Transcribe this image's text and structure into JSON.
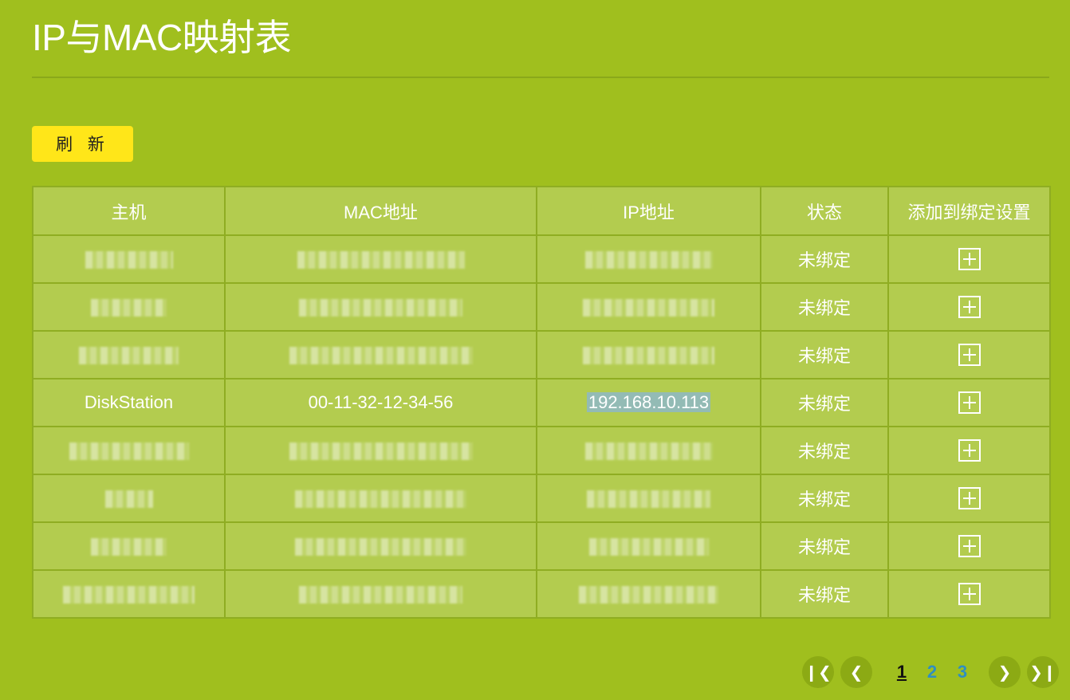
{
  "page": {
    "title": "IP与MAC映射表"
  },
  "toolbar": {
    "refresh_label": "刷 新"
  },
  "table": {
    "headers": {
      "host": "主机",
      "mac": "MAC地址",
      "ip": "IP地址",
      "status": "状态",
      "add_binding": "添加到绑定设置"
    },
    "rows": [
      {
        "host": "",
        "mac": "",
        "ip": "",
        "status": "未绑定",
        "redacted": true
      },
      {
        "host": "",
        "mac": "",
        "ip": "",
        "status": "未绑定",
        "redacted": true
      },
      {
        "host": "",
        "mac": "",
        "ip": "",
        "status": "未绑定",
        "redacted": true
      },
      {
        "host": "DiskStation",
        "mac": "00-11-32-12-34-56",
        "ip": "192.168.10.113",
        "status": "未绑定",
        "redacted": false
      },
      {
        "host": "",
        "mac": "",
        "ip": "",
        "status": "未绑定",
        "redacted": true
      },
      {
        "host": "",
        "mac": "",
        "ip": "",
        "status": "未绑定",
        "redacted": true
      },
      {
        "host": "",
        "mac": "",
        "ip": "",
        "status": "未绑定",
        "redacted": true
      },
      {
        "host": "",
        "mac": "",
        "ip": "",
        "status": "未绑定",
        "redacted": true
      }
    ]
  },
  "pagination": {
    "pages": [
      "1",
      "2",
      "3"
    ],
    "current": "1",
    "first_icon": "first-page-icon",
    "prev_icon": "previous-page-icon",
    "next_icon": "next-page-icon",
    "last_icon": "last-page-icon"
  },
  "colors": {
    "background": "#a0bf1e",
    "table_cell": "#b3cc4f",
    "button": "#ffe619",
    "page_link": "#2f8fc1",
    "highlight": "#93bbb5"
  }
}
